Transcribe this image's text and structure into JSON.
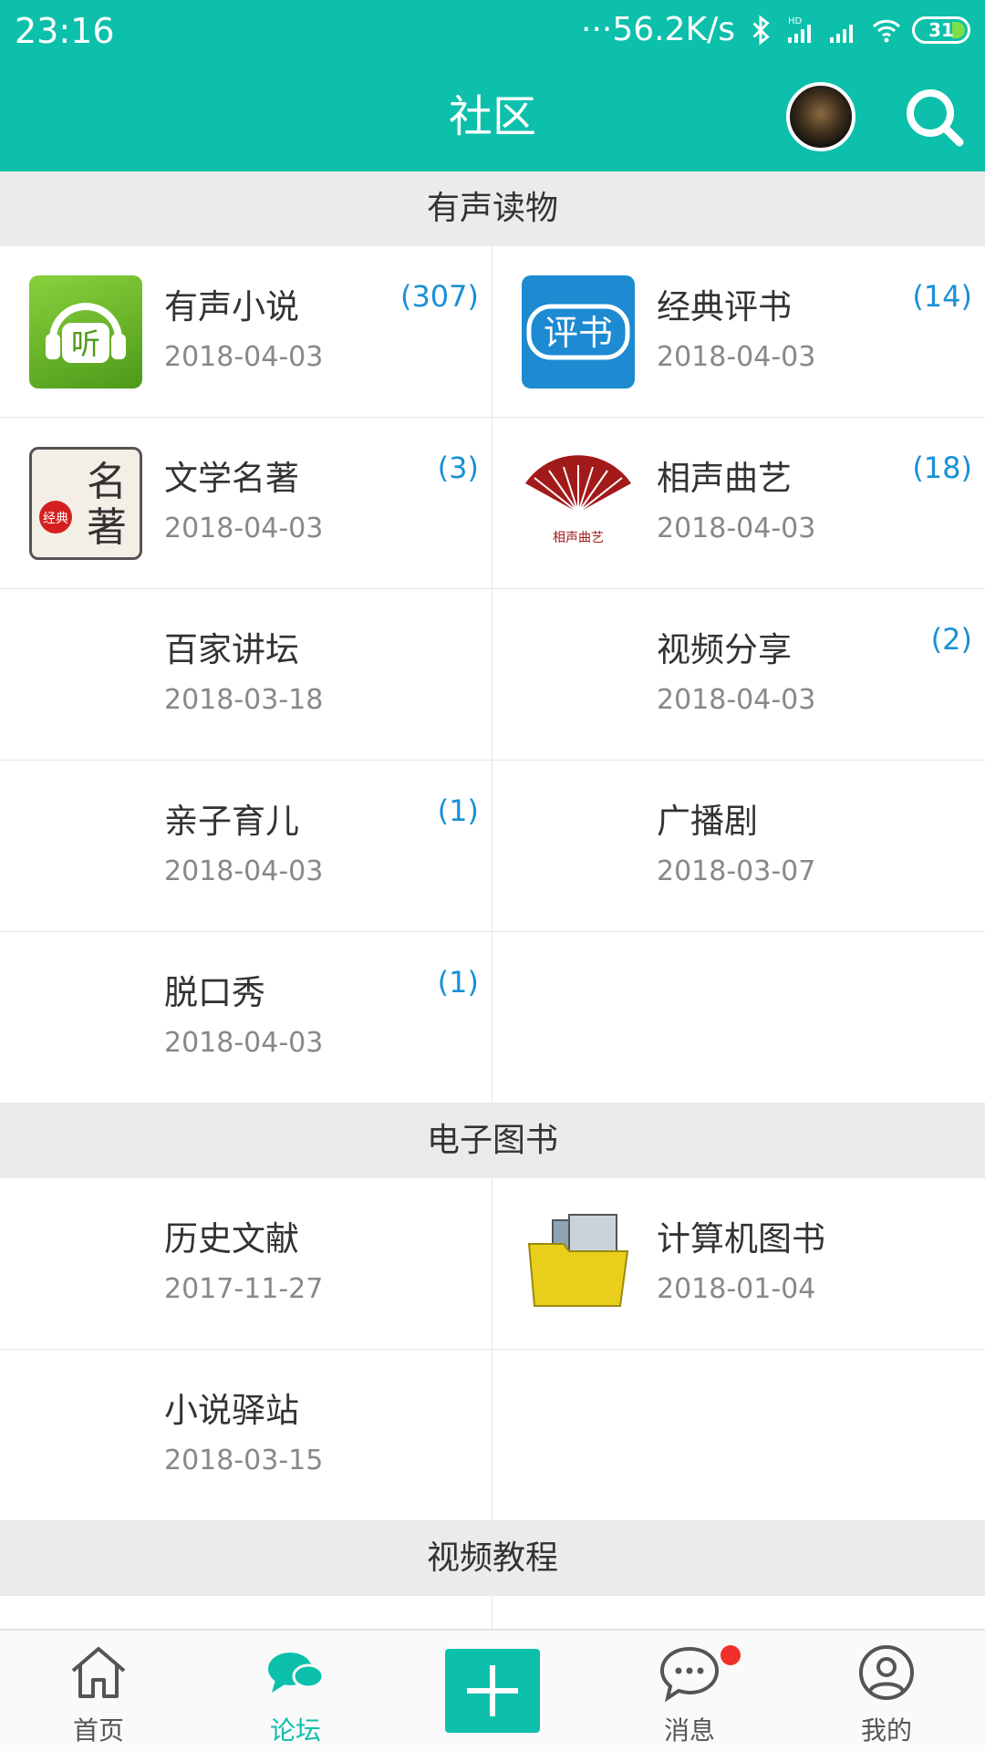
{
  "status_bar": {
    "time": "23:16",
    "network_speed": "···56.2K/s",
    "battery": "31",
    "icons": [
      "bluetooth-icon",
      "hd-signal-icon",
      "signal-icon",
      "wifi-icon",
      "battery-icon"
    ]
  },
  "header": {
    "title": "社区",
    "avatar_icon": "avatar",
    "search_icon": "search-icon"
  },
  "colors": {
    "primary": "#0cc0ab",
    "count_blue": "#1a90d6",
    "section_bg": "#ebebeb",
    "badge_red": "#f0302a"
  },
  "sections": [
    {
      "title": "有声读物",
      "items": [
        {
          "name": "有声小说",
          "date": "2018-04-03",
          "count": "(307)",
          "icon": "ting-icon"
        },
        {
          "name": "经典评书",
          "date": "2018-04-03",
          "count": "(14)",
          "icon": "pingshu-icon"
        },
        {
          "name": "文学名著",
          "date": "2018-04-03",
          "count": "(3)",
          "icon": "mingzhu-icon"
        },
        {
          "name": "相声曲艺",
          "date": "2018-04-03",
          "count": "(18)",
          "icon": "xiangsheng-fan-icon"
        },
        {
          "name": "百家讲坛",
          "date": "2018-03-18",
          "count": "",
          "icon": ""
        },
        {
          "name": "视频分享",
          "date": "2018-04-03",
          "count": "(2)",
          "icon": ""
        },
        {
          "name": "亲子育儿",
          "date": "2018-04-03",
          "count": "(1)",
          "icon": ""
        },
        {
          "name": "广播剧",
          "date": "2018-03-07",
          "count": "",
          "icon": ""
        },
        {
          "name": "脱口秀",
          "date": "2018-04-03",
          "count": "(1)",
          "icon": ""
        }
      ]
    },
    {
      "title": "电子图书",
      "items": [
        {
          "name": "历史文献",
          "date": "2017-11-27",
          "count": "",
          "icon": ""
        },
        {
          "name": "计算机图书",
          "date": "2018-01-04",
          "count": "",
          "icon": "folder-icon"
        },
        {
          "name": "小说驿站",
          "date": "2018-03-15",
          "count": "",
          "icon": ""
        }
      ]
    },
    {
      "title": "视频教程",
      "items": []
    }
  ],
  "icon_texts": {
    "ting": "听",
    "pingshu": "评书",
    "mingzhu_1": "名",
    "mingzhu_2": "著",
    "mingzhu_seal": "经典",
    "xiangsheng_caption": "相声曲艺"
  },
  "bottom_nav": {
    "items": [
      {
        "label": "首页",
        "icon": "home-icon",
        "active": false
      },
      {
        "label": "论坛",
        "icon": "forum-chat-icon",
        "active": true
      },
      {
        "label": "",
        "icon": "plus-icon",
        "active": false
      },
      {
        "label": "消息",
        "icon": "message-icon",
        "active": false,
        "badge": true
      },
      {
        "label": "我的",
        "icon": "profile-icon",
        "active": false
      }
    ]
  }
}
